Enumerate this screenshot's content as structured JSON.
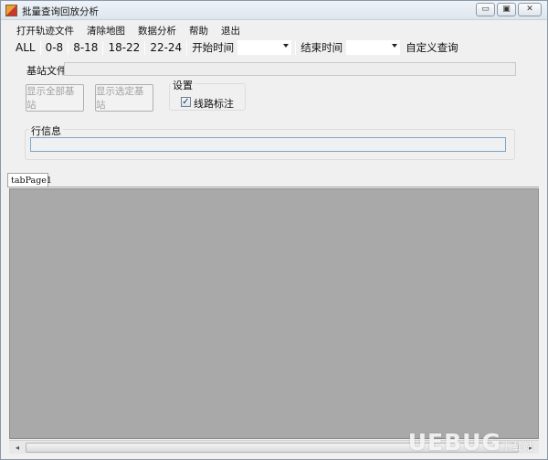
{
  "window": {
    "title": "批量查询回放分析",
    "caption": {
      "minimize": "▭",
      "maximize": "▣",
      "close": "✕"
    }
  },
  "menu": [
    {
      "label": "打开轨迹文件"
    },
    {
      "label": "清除地图"
    },
    {
      "label": "数据分析"
    },
    {
      "label": "帮助"
    },
    {
      "label": "退出"
    }
  ],
  "toolbar": {
    "ranges": [
      "ALL",
      "0-8",
      "8-18",
      "18-22",
      "22-24"
    ],
    "start_label": "开始时间",
    "start_value": "",
    "end_label": "结束时间",
    "end_value": "",
    "custom_query": "自定义查询"
  },
  "base_station": {
    "label": "基站文件",
    "value": ""
  },
  "buttons": {
    "show_all": "显示全部基站",
    "show_selected": "显示选定基站"
  },
  "settings": {
    "title": "设置",
    "route_label": "线路标注",
    "route_checked": true,
    "check_glyph": "✓"
  },
  "row_info": {
    "title": "行信息",
    "value": ""
  },
  "tabs": [
    {
      "label": "tabPage1"
    }
  ],
  "watermark": {
    "text": "UEBUG",
    "suffix": "下载站"
  },
  "icons": {
    "scroll_left": "◂",
    "scroll_right": "▸"
  }
}
